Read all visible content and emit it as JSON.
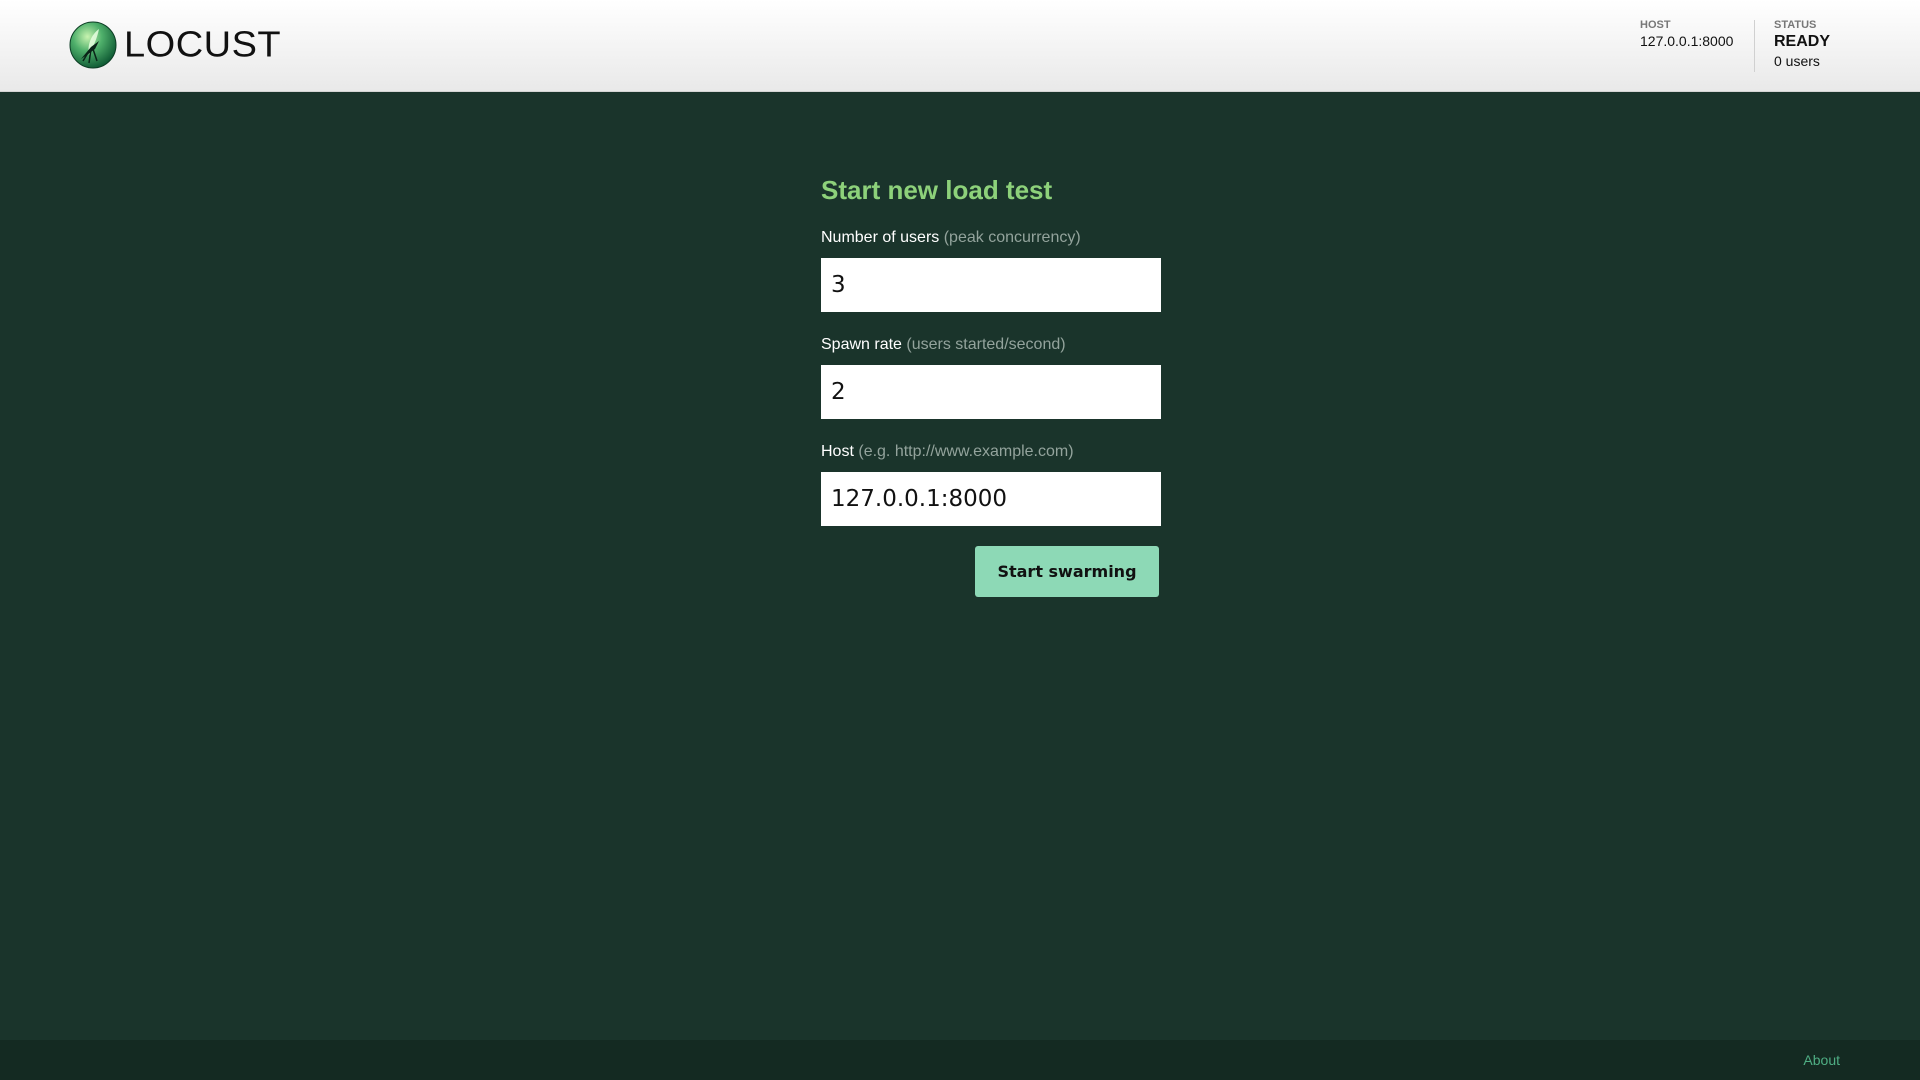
{
  "header": {
    "logo_text": "LOCUST",
    "host": {
      "label": "HOST",
      "value": "127.0.0.1:8000"
    },
    "status": {
      "label": "STATUS",
      "value": "READY",
      "users": "0 users"
    }
  },
  "form": {
    "title": "Start new load test",
    "users": {
      "label": "Number of users",
      "hint": "(peak concurrency)",
      "value": "3"
    },
    "spawn_rate": {
      "label": "Spawn rate",
      "hint": "(users started/second)",
      "value": "2"
    },
    "host": {
      "label": "Host",
      "hint": "(e.g. http://www.example.com)",
      "value": "127.0.0.1:8000"
    },
    "submit_label": "Start swarming"
  },
  "footer": {
    "about_label": "About"
  },
  "colors": {
    "background": "#1a342b",
    "title_green": "#8dd17a",
    "button": "#8dd9b6",
    "footer": "#142a22",
    "link": "#4fae84"
  }
}
